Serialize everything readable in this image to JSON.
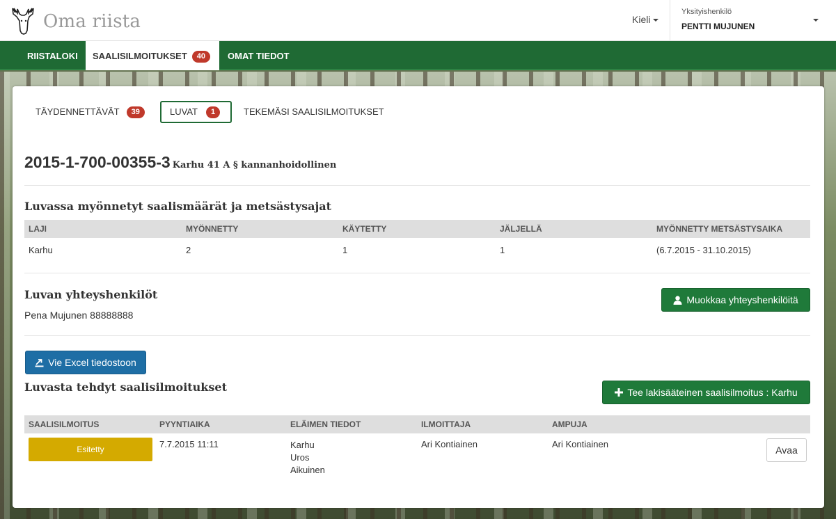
{
  "header": {
    "brand": "Oma riista",
    "language_label": "Kieli",
    "account_role": "Yksityishenkilö",
    "account_name": "PENTTI MUJUNEN"
  },
  "nav": {
    "items": [
      {
        "label": "RIISTALOKI"
      },
      {
        "label": "SAALISILMOITUKSET",
        "badge": "40"
      },
      {
        "label": "OMAT TIEDOT"
      }
    ]
  },
  "subtabs": [
    {
      "label": "TÄYDENNETTÄVÄT",
      "badge": "39"
    },
    {
      "label": "LUVAT",
      "badge": "1"
    },
    {
      "label": "TEKEMÄSI SAALISILMOITUKSET"
    }
  ],
  "permit": {
    "number": "2015-1-700-00355-3",
    "type": "Karhu 41 A § kannanhoidollinen"
  },
  "quota": {
    "heading": "Luvassa myönnetyt saalismäärät ja metsästysajat",
    "columns": [
      "LAJI",
      "MYÖNNETTY",
      "KÄYTETTY",
      "JÄLJELLÄ",
      "MYÖNNETTY METSÄSTYSAIKA"
    ],
    "rows": [
      [
        "Karhu",
        "2",
        "1",
        "1",
        "(6.7.2015 - 31.10.2015)"
      ]
    ]
  },
  "contacts": {
    "heading": "Luvan yhteyshenkilöt",
    "text": "Pena Mujunen 88888888",
    "edit_button": "Muokkaa yhteyshenkilöitä"
  },
  "reports": {
    "export_button": "Vie Excel tiedostoon",
    "heading": "Luvasta tehdyt saalisilmoitukset",
    "add_button": "Tee lakisääteinen saalisilmoitus : Karhu",
    "columns": [
      "SAALISILMOITUS",
      "PYYNTIAIKA",
      "ELÄIMEN TIEDOT",
      "ILMOITTAJA",
      "AMPUJA"
    ],
    "rows": [
      {
        "status": "Esitetty",
        "time": "7.7.2015 11:11",
        "animal": [
          "Karhu",
          "Uros",
          "Aikuinen"
        ],
        "reporter": "Ari Kontiainen",
        "shooter": "Ari Kontiainen",
        "open_button": "Avaa"
      }
    ]
  },
  "colors": {
    "primary_green": "#1f6a34",
    "button_blue": "#1e6ea5",
    "badge_red": "#c0392b",
    "status_yellow": "#d4aa00"
  }
}
